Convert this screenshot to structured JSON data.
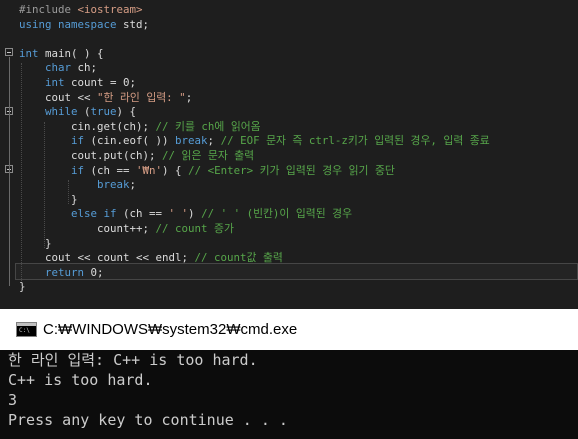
{
  "editor": {
    "lines": [
      [
        {
          "t": "#include ",
          "c": "pp"
        },
        {
          "t": "<iostream>",
          "c": "inc"
        }
      ],
      [
        {
          "t": "using ",
          "c": "kw"
        },
        {
          "t": "namespace ",
          "c": "kw"
        },
        {
          "t": "std;",
          "c": "plain"
        }
      ],
      [],
      [
        {
          "t": "int ",
          "c": "kw"
        },
        {
          "t": "main",
          "c": "plain"
        },
        {
          "t": "( ) {",
          "c": "plain"
        }
      ],
      [
        {
          "t": "    char ",
          "c": "kw"
        },
        {
          "t": "ch;",
          "c": "plain"
        }
      ],
      [
        {
          "t": "    int ",
          "c": "kw"
        },
        {
          "t": "count = 0;",
          "c": "plain"
        }
      ],
      [
        {
          "t": "    cout << ",
          "c": "plain"
        },
        {
          "t": "\"한 라인 입력: \"",
          "c": "str"
        },
        {
          "t": ";",
          "c": "plain"
        }
      ],
      [
        {
          "t": "    while",
          "c": "kw"
        },
        {
          "t": " (",
          "c": "plain"
        },
        {
          "t": "true",
          "c": "kw"
        },
        {
          "t": ") {",
          "c": "plain"
        }
      ],
      [
        {
          "t": "        cin.get(ch); ",
          "c": "plain"
        },
        {
          "t": "// 키를 ch에 읽어옴",
          "c": "cmt"
        }
      ],
      [
        {
          "t": "        if ",
          "c": "kw"
        },
        {
          "t": "(cin.eof( )) ",
          "c": "plain"
        },
        {
          "t": "break",
          "c": "kw"
        },
        {
          "t": "; ",
          "c": "plain"
        },
        {
          "t": "// EOF 문자 즉 ctrl-z키가 입력된 경우, 입력 종료",
          "c": "cmt"
        }
      ],
      [
        {
          "t": "        cout.put(ch); ",
          "c": "plain"
        },
        {
          "t": "// 읽은 문자 출력",
          "c": "cmt"
        }
      ],
      [
        {
          "t": "        if ",
          "c": "kw"
        },
        {
          "t": "(ch == ",
          "c": "plain"
        },
        {
          "t": "'₩n'",
          "c": "str"
        },
        {
          "t": ") { ",
          "c": "plain"
        },
        {
          "t": "// <Enter> 키가 입력된 경우 읽기 중단",
          "c": "cmt"
        }
      ],
      [
        {
          "t": "            break",
          "c": "kw"
        },
        {
          "t": ";",
          "c": "plain"
        }
      ],
      [
        {
          "t": "        }",
          "c": "plain"
        }
      ],
      [
        {
          "t": "        else if ",
          "c": "kw"
        },
        {
          "t": "(ch == ",
          "c": "plain"
        },
        {
          "t": "' '",
          "c": "str"
        },
        {
          "t": ") ",
          "c": "plain"
        },
        {
          "t": "// ' ' (빈칸)이 입력된 경우",
          "c": "cmt"
        }
      ],
      [
        {
          "t": "            count++; ",
          "c": "plain"
        },
        {
          "t": "// count 증가",
          "c": "cmt"
        }
      ],
      [
        {
          "t": "    }",
          "c": "plain"
        }
      ],
      [
        {
          "t": "    cout << count << endl; ",
          "c": "plain"
        },
        {
          "t": "// count값 출력",
          "c": "cmt"
        }
      ],
      [
        {
          "t": "    return ",
          "c": "kw"
        },
        {
          "t": "0;",
          "c": "plain"
        }
      ],
      [
        {
          "t": "}",
          "c": "plain"
        }
      ]
    ],
    "colors": {
      "background": "#1e1e1e",
      "keyword": "#569cd6",
      "string": "#d69d85",
      "comment": "#57a64a",
      "text": "#dcdcdc"
    }
  },
  "cmd": {
    "title": "C:₩WINDOWS₩system32₩cmd.exe",
    "icon": "cmd-window-icon",
    "output": [
      "한 라인 입력: C++ is too hard.",
      "C++ is too hard.",
      "3",
      "Press any key to continue . . ."
    ]
  }
}
